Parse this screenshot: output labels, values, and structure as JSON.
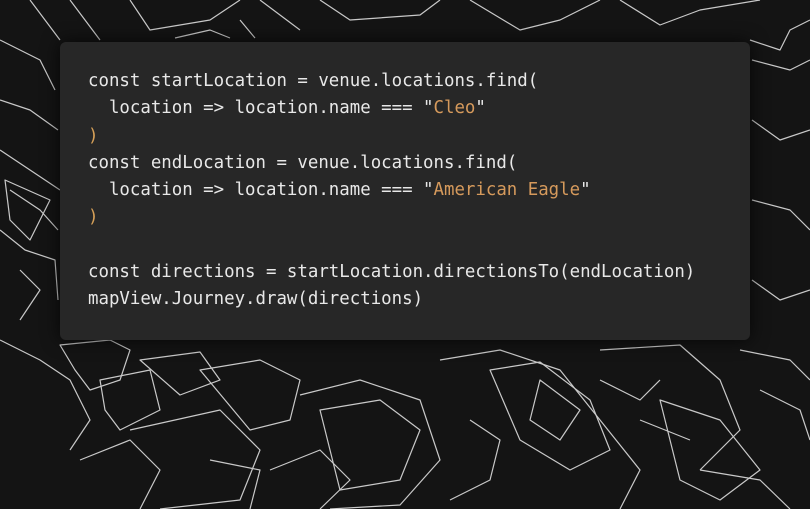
{
  "code": {
    "line1": "const startLocation = venue.locations.find(",
    "line2_pre": "  location => location.name === \"",
    "line2_str": "Cleo",
    "line2_post": "\"",
    "line3": ")",
    "line4": "const endLocation = venue.locations.find(",
    "line5_pre": "  location => location.name === \"",
    "line5_str": "American Eagle",
    "line5_post": "\"",
    "line6": ")",
    "line7": "",
    "line8": "const directions = startLocation.directionsTo(endLocation)",
    "line9": "mapView.Journey.draw(directions)"
  },
  "colors": {
    "background": "#141414",
    "card": "#272727",
    "text": "#e8e8e8",
    "string": "#d69a5c"
  }
}
